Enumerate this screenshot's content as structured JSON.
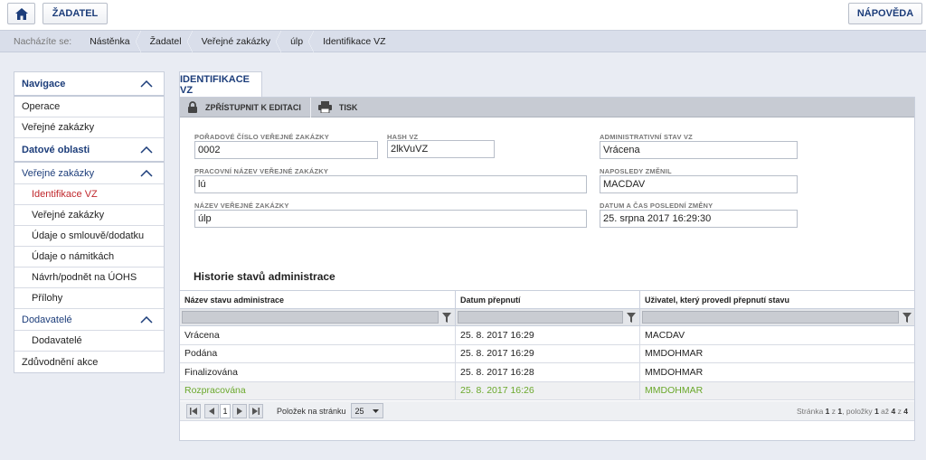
{
  "topbar": {
    "home_icon": "home-icon",
    "zadatel_label": "ŽADATEL",
    "help_label": "NÁPOVĚDA"
  },
  "breadcrumb": {
    "label": "Nacházíte se:",
    "items": [
      "Nástěnka",
      "Žadatel",
      "Veřejné zakázky",
      "úlp",
      "Identifikace VZ"
    ]
  },
  "sidebar": {
    "nav_title": "Navigace",
    "operace": "Operace",
    "verejne_zakazky": "Veřejné zakázky",
    "datove_oblasti": "Datové oblasti",
    "verejne_zakazky_group": "Veřejné zakázky",
    "vz_children": [
      "Identifikace VZ",
      "Veřejné zakázky",
      "Údaje o smlouvě/dodatku",
      "Údaje o námitkách",
      "Návrh/podnět na ÚOHS",
      "Přílohy"
    ],
    "dodavatele_group": "Dodavatelé",
    "dodavatele_child": "Dodavatelé",
    "zduvodneni": "Zdůvodnění akce"
  },
  "tab": {
    "label": "IDENTIFIKACE VZ"
  },
  "toolbar": {
    "edit_label": "ZPŘÍSTUPNIT K EDITACI",
    "print_label": "TISK"
  },
  "form": {
    "poradove_label": "POŘADOVÉ ČÍSLO VEŘEJNÉ ZAKÁZKY",
    "poradove_value": "0002",
    "hash_label": "HASH VZ",
    "hash_value": "2lkVuVZ",
    "admin_stav_label": "ADMINISTRATIVNÍ STAV VZ",
    "admin_stav_value": "Vrácena",
    "pracovni_label": "PRACOVNÍ NÁZEV VEŘEJNÉ ZAKÁZKY",
    "pracovni_value": "lú",
    "naposledy_label": "NAPOSLEDY ZMĚNIL",
    "naposledy_value": "MACDAV",
    "nazev_label": "NÁZEV VEŘEJNÉ ZAKÁZKY",
    "nazev_value": "úlp",
    "datum_label": "DATUM A ČAS POSLEDNÍ ZMĚNY",
    "datum_value": "25. srpna 2017 16:29:30"
  },
  "history": {
    "title": "Historie stavů administrace",
    "columns": [
      "Název stavu administrace",
      "Datum přepnutí",
      "Uživatel, který provedl přepnutí stavu"
    ],
    "rows": [
      [
        "Vrácena",
        "25. 8. 2017 16:29",
        "MACDAV"
      ],
      [
        "Podána",
        "25. 8. 2017 16:29",
        "MMDOHMAR"
      ],
      [
        "Finalizována",
        "25. 8. 2017 16:28",
        "MMDOHMAR"
      ],
      [
        "Rozpracována",
        "25. 8. 2017 16:26",
        "MMDOHMAR"
      ]
    ],
    "highlight_color": "#6aa82b"
  },
  "pager": {
    "current_page": "1",
    "per_page_label": "Položek na stránku",
    "per_page_value": "25",
    "info_prefix": "Stránka",
    "info_page": "1",
    "info_z1": "z",
    "info_total_pages": "1",
    "info_mid": ", položky",
    "info_from": "1",
    "info_az": "až",
    "info_to": "4",
    "info_z2": "z",
    "info_total": "4"
  }
}
